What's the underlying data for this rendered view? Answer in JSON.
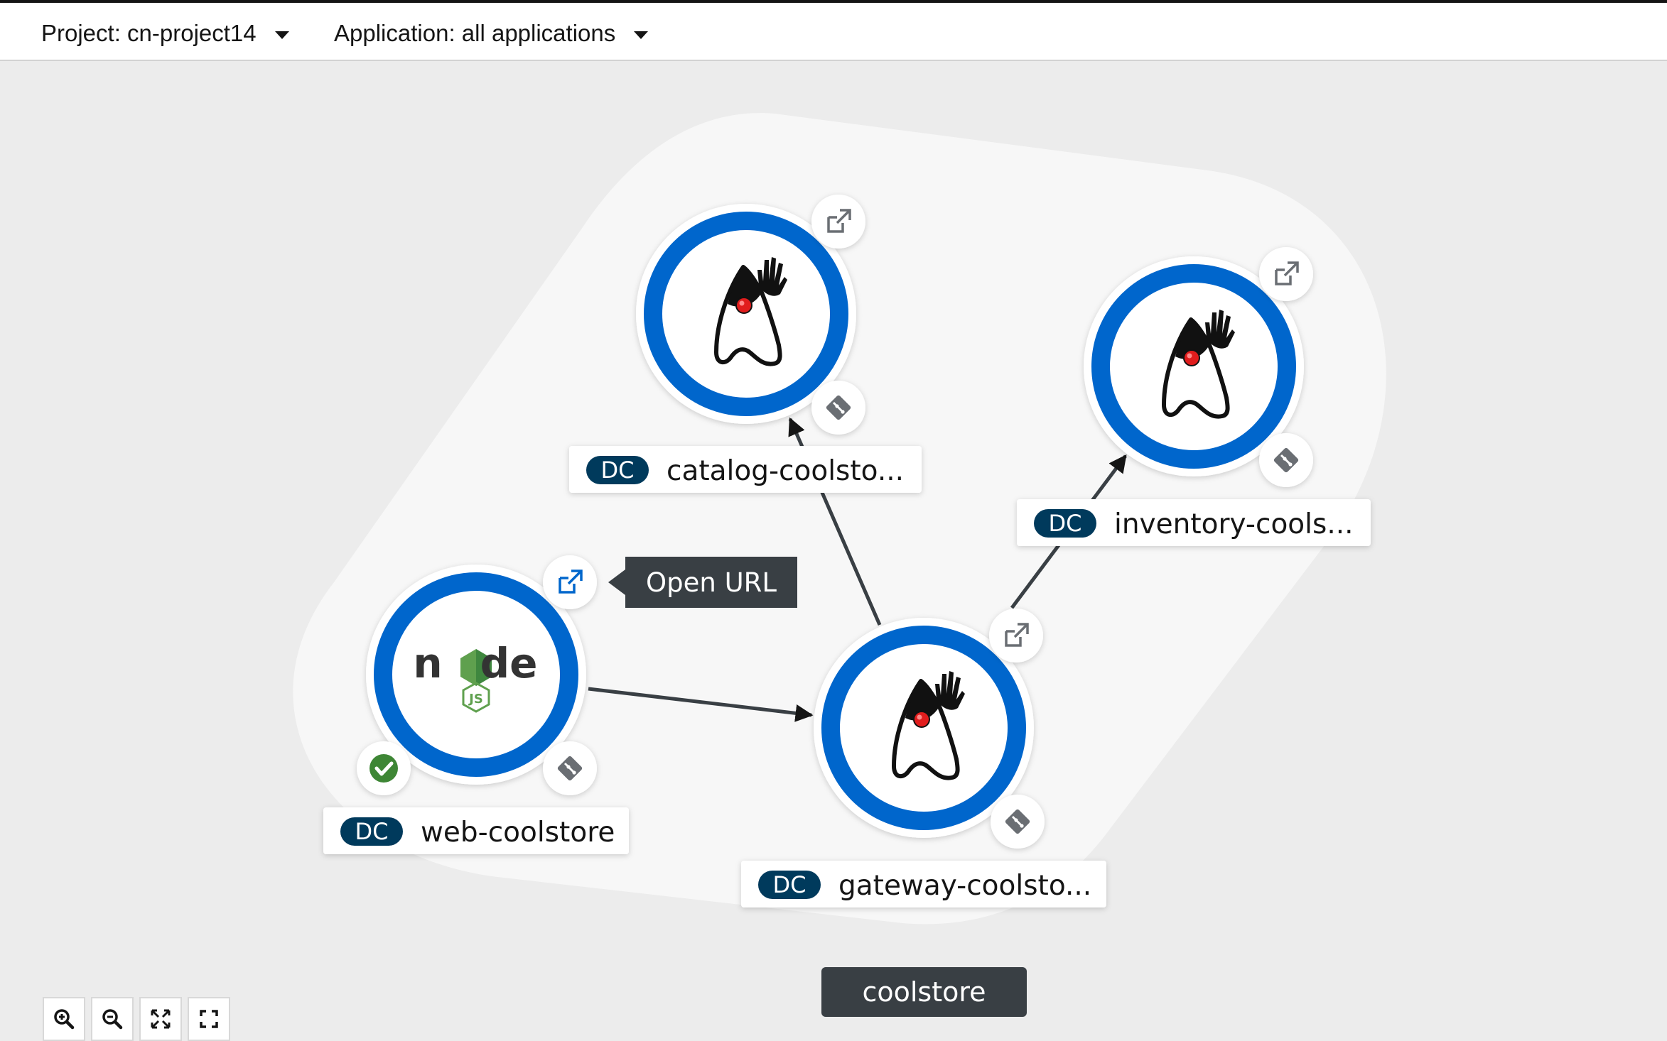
{
  "header": {
    "project_label": "Project: cn-project14",
    "application_label": "Application: all applications"
  },
  "group": {
    "name": "coolstore"
  },
  "tooltip": {
    "text": "Open URL"
  },
  "nodes": [
    {
      "kind": "DC",
      "name": "catalog-coolsto...",
      "runtime": "java-duke-icon"
    },
    {
      "kind": "DC",
      "name": "inventory-cools...",
      "runtime": "java-duke-icon"
    },
    {
      "kind": "DC",
      "name": "web-coolstore",
      "runtime": "nodejs-icon",
      "status": "success"
    },
    {
      "kind": "DC",
      "name": "gateway-coolsto...",
      "runtime": "java-duke-icon"
    }
  ],
  "nodejs_logo": {
    "word_left": "n",
    "word_right": "de",
    "badge": "JS"
  },
  "edges": [
    {
      "from": "web-coolstore",
      "to": "gateway-coolsto..."
    },
    {
      "from": "gateway-coolsto...",
      "to": "catalog-coolsto..."
    },
    {
      "from": "gateway-coolsto...",
      "to": "inventory-cools..."
    }
  ],
  "colors": {
    "ring": "#0066cc",
    "dc_badge": "#003a5c",
    "status_ok": "#3e8635",
    "edge": "#393f44"
  },
  "controls": [
    "zoom-in-icon",
    "zoom-out-icon",
    "fit-to-screen-icon",
    "reset-view-icon"
  ]
}
